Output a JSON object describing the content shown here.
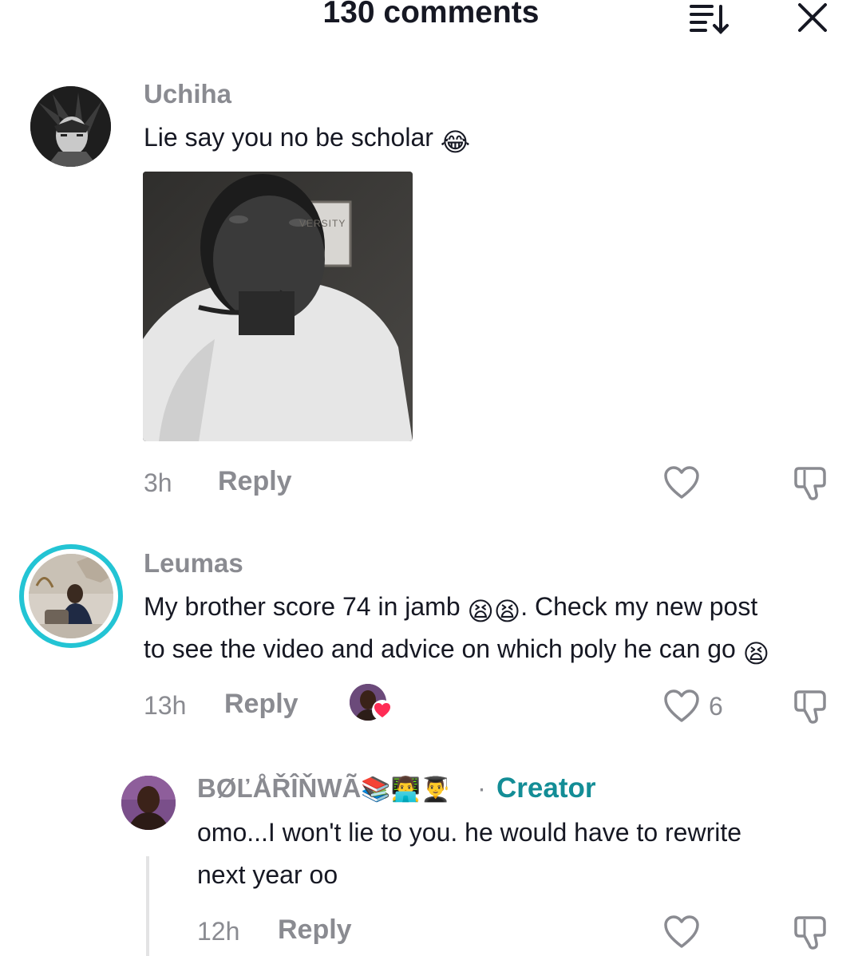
{
  "header": {
    "title": "130 comments"
  },
  "comments": [
    {
      "username": "Uchiha",
      "text": "Lie say you no be scholar",
      "emoji": "😂",
      "sticker_text": "VERSITY",
      "time": "3h",
      "reply_label": "Reply"
    },
    {
      "username": "Leumas",
      "text_line1": "My brother score 74 in jamb",
      "emoji1": "😫😫",
      "text_line1b": ". Check my new post",
      "text_line2": "to see the video and advice on which poly he can go",
      "emoji2": "😫",
      "time": "13h",
      "reply_label": "Reply",
      "like_count": "6"
    },
    {
      "username": "BØĽÅŘÎŇWÃ",
      "username_emoji": "📚👨‍💻👨‍🎓",
      "separator": "·",
      "creator_label": "Creator",
      "text_line1": "omo...I won't lie to you. he would have to rewrite",
      "text_line2": "next year oo",
      "time": "12h",
      "reply_label": "Reply"
    }
  ],
  "icons": [
    "sort-icon",
    "close-icon",
    "heart-icon",
    "dislike-icon"
  ],
  "colors": {
    "accent_creator": "#138d96",
    "muted": "#8a8b91",
    "text": "#161823",
    "avatar_ring": "#23c4d4",
    "heart": "#fe2c55"
  }
}
